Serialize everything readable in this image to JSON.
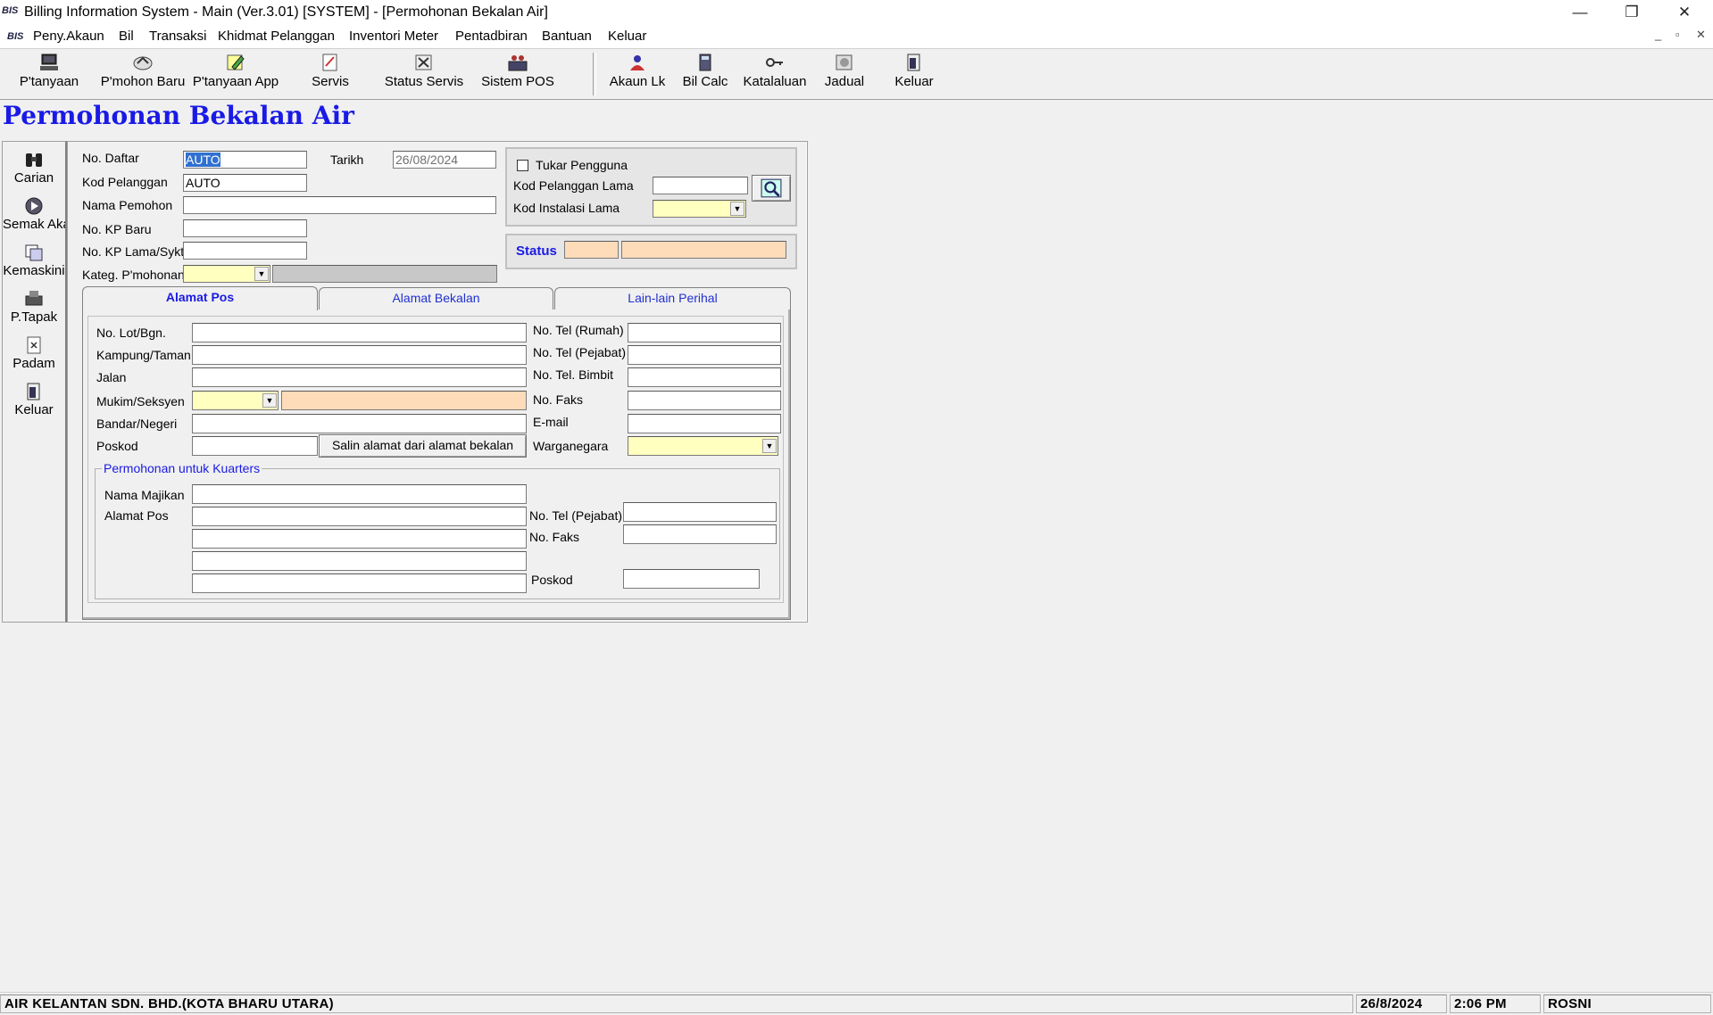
{
  "window": {
    "title": "Billing Information System - Main  (Ver.3.01)  [SYSTEM] - [Permohonan Bekalan Air]",
    "app_icon_text": "BIS",
    "minimize": "—",
    "restore": "❐",
    "close": "✕"
  },
  "menu": {
    "items": [
      "Peny.Akaun",
      "Bil",
      "Transaksi",
      "Khidmat Pelanggan",
      "Inventori Meter",
      "Pentadbiran",
      "Bantuan",
      "Keluar"
    ],
    "mdi_min": "_",
    "mdi_restore": "▫",
    "mdi_close": "✕"
  },
  "toolbar": {
    "items": [
      {
        "label": "P'tanyaan",
        "icon": "computer-icon"
      },
      {
        "label": "P'mohon Baru",
        "icon": "new-application-icon"
      },
      {
        "label": "P'tanyaan App",
        "icon": "pencil-icon"
      },
      {
        "label": "Servis",
        "icon": "service-icon"
      },
      {
        "label": "Status Servis",
        "icon": "tools-icon"
      },
      {
        "label": "Sistem POS",
        "icon": "pos-icon"
      },
      {
        "label": "Akaun Lk",
        "icon": "account-icon"
      },
      {
        "label": "Bil Calc",
        "icon": "calculator-icon"
      },
      {
        "label": "Katalaluan",
        "icon": "key-icon"
      },
      {
        "label": "Jadual",
        "icon": "schedule-icon"
      },
      {
        "label": "Keluar",
        "icon": "exit-icon"
      }
    ]
  },
  "form": {
    "title": "Permohonan Bekalan Air",
    "sidebar": [
      {
        "label": "Carian",
        "icon": "binoculars-icon"
      },
      {
        "label": "Semak Akaun",
        "icon": "play-icon"
      },
      {
        "label": "Kemaskini",
        "icon": "edit-icon"
      },
      {
        "label": "P.Tapak",
        "icon": "stamp-icon"
      },
      {
        "label": "Padam",
        "icon": "delete-icon"
      },
      {
        "label": "Keluar",
        "icon": "exit-icon"
      }
    ],
    "header": {
      "no_daftar_label": "No. Daftar",
      "no_daftar_value": "AUTO",
      "tarikh_label": "Tarikh",
      "tarikh_value": "26/08/2024",
      "kod_pelanggan_label": "Kod Pelanggan",
      "kod_pelanggan_value": "AUTO",
      "nama_pemohon_label": "Nama Pemohon",
      "no_kp_baru_label": "No. KP Baru",
      "no_kp_lama_label": "No. KP Lama/Sykt",
      "kateg_label": "Kateg. P'mohonan"
    },
    "tukar": {
      "checkbox_label": "Tukar Pengguna",
      "checked": false,
      "kod_pelanggan_lama_label": "Kod Pelanggan Lama",
      "kod_instalasi_lama_label": "Kod Instalasi Lama"
    },
    "status": {
      "label": "Status"
    },
    "tabs": [
      "Alamat Pos",
      "Alamat Bekalan",
      "Lain-lain Perihal"
    ],
    "active_tab": 0,
    "alamat_pos": {
      "no_lot_label": "No. Lot/Bgn.",
      "kampung_label": "Kampung/Taman",
      "jalan_label": "Jalan",
      "mukim_label": "Mukim/Seksyen",
      "bandar_label": "Bandar/Negeri",
      "poskod_label": "Poskod",
      "salin_button": "Salin alamat dari alamat bekalan",
      "tel_rumah_label": "No. Tel (Rumah)",
      "tel_pejabat_label": "No. Tel (Pejabat)",
      "tel_bimbit_label": "No. Tel. Bimbit",
      "faks_label": "No. Faks",
      "email_label": "E-mail",
      "warganegara_label": "Warganegara"
    },
    "kuarters": {
      "group_label": "Permohonan untuk Kuarters",
      "nama_majikan_label": "Nama Majikan",
      "alamat_pos_label": "Alamat Pos",
      "tel_pejabat_label": "No. Tel (Pejabat)",
      "faks_label": "No. Faks",
      "poskod_label": "Poskod"
    }
  },
  "statusbar": {
    "company": "AIR KELANTAN SDN. BHD.(KOTA BHARU UTARA)",
    "date": "26/8/2024",
    "time": "2:06 PM",
    "user": "ROSNI"
  }
}
